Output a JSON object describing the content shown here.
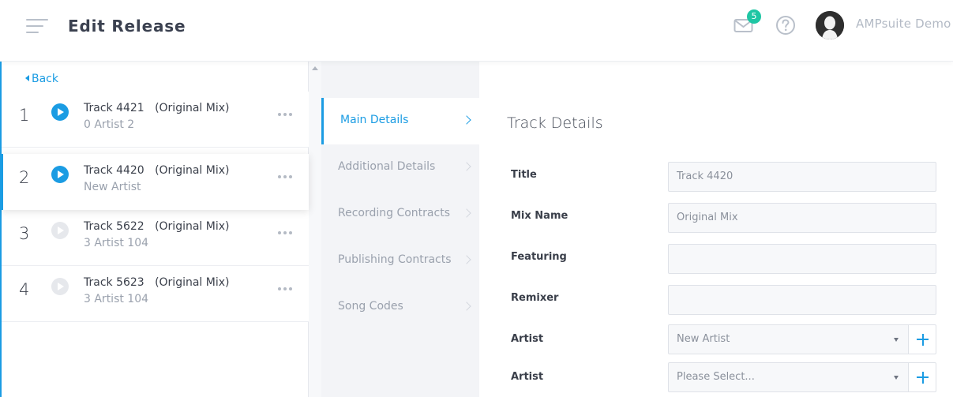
{
  "header": {
    "page_title": "Edit Release",
    "mail_badge_count": "5",
    "user_name": "AMPsuite Demo"
  },
  "track_panel": {
    "back_label": "Back",
    "tracks": [
      {
        "number": "1",
        "title": "Track 4421   (Original Mix)",
        "artist": "0 Artist 2",
        "playing": true
      },
      {
        "number": "2",
        "title": "Track 4420   (Original Mix)",
        "artist": "New Artist",
        "playing": true,
        "selected": true
      },
      {
        "number": "3",
        "title": "Track 5622   (Original Mix)",
        "artist": "3 Artist 104",
        "playing": false
      },
      {
        "number": "4",
        "title": "Track 5623   (Original Mix)",
        "artist": "3 Artist 104",
        "playing": false
      }
    ]
  },
  "section_nav": {
    "items": [
      {
        "label": "Main Details",
        "active": true
      },
      {
        "label": "Additional Details"
      },
      {
        "label": "Recording Contracts"
      },
      {
        "label": "Publishing Contracts"
      },
      {
        "label": "Song Codes"
      }
    ]
  },
  "form": {
    "section_title": "Track Details",
    "fields": {
      "title": {
        "label": "Title",
        "value": "Track 4420"
      },
      "mix_name": {
        "label": "Mix Name",
        "value": "Original Mix"
      },
      "featuring": {
        "label": "Featuring",
        "value": ""
      },
      "remixer": {
        "label": "Remixer",
        "value": ""
      },
      "artist_1": {
        "label": "Artist",
        "value": "New Artist"
      },
      "artist_2": {
        "label": "Artist",
        "value": "Please Select..."
      }
    }
  },
  "colors": {
    "accent": "#1b9ce3",
    "badge": "#1fc6a4",
    "nav_background": "#f3f4f7"
  }
}
